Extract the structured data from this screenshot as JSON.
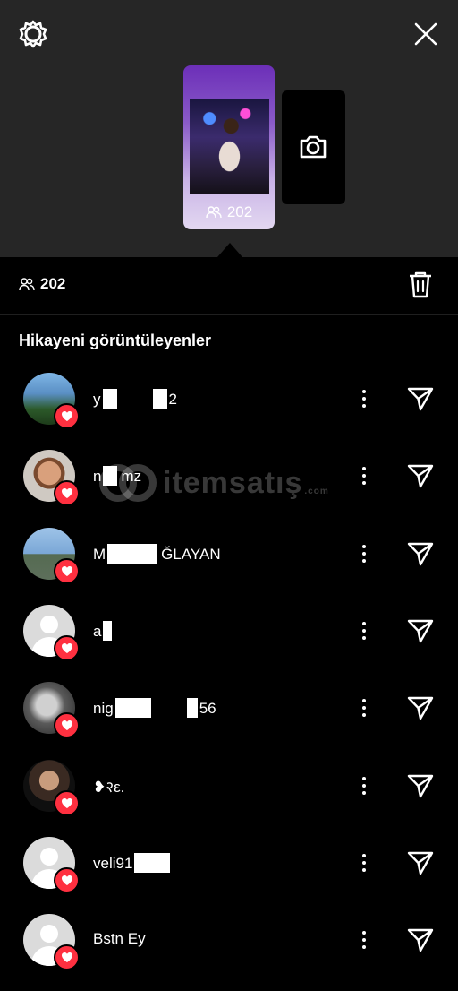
{
  "header": {
    "settings_icon": "gear-icon",
    "close_icon": "close-icon"
  },
  "story": {
    "views": "202",
    "camera_icon": "camera-icon"
  },
  "stats": {
    "views": "202",
    "delete_icon": "trash-icon"
  },
  "section_title": "Hikayeni görüntüleyenler",
  "viewers": [
    {
      "prefix": "y",
      "censor1": 16,
      "mid": "",
      "censor2": 16,
      "suffix": "2",
      "avatar": "photo-lake"
    },
    {
      "prefix": "n",
      "censor1": 16,
      "mid": "",
      "censor2": 0,
      "suffix": "mz",
      "avatar": "photo-man-smile"
    },
    {
      "prefix": "M",
      "censor1": 56,
      "mid": "",
      "censor2": 0,
      "suffix": "ĞLAYAN",
      "avatar": "photo-man-sea"
    },
    {
      "prefix": "a",
      "censor1": 10,
      "mid": "",
      "censor2": 0,
      "suffix": "",
      "avatar": "default"
    },
    {
      "prefix": "nig",
      "censor1": 40,
      "mid": "",
      "censor2": 12,
      "suffix": "56",
      "avatar": "photo-bw"
    },
    {
      "prefix": "❥२ε.",
      "censor1": 0,
      "mid": "",
      "censor2": 0,
      "suffix": "",
      "avatar": "photo-man-dark"
    },
    {
      "prefix": "veli91",
      "censor1": 40,
      "mid": "",
      "censor2": 0,
      "suffix": "",
      "avatar": "default"
    },
    {
      "prefix": "Bstn Ey",
      "censor1": 0,
      "mid": "",
      "censor2": 0,
      "suffix": "",
      "avatar": "default"
    }
  ],
  "watermark": {
    "text": "itemsatış",
    "suffix": ".com"
  },
  "colors": {
    "header_bg": "#262626",
    "background": "#000000",
    "heart_badge": "#ff3040",
    "story_gradient_top": "#6c2fb8"
  }
}
